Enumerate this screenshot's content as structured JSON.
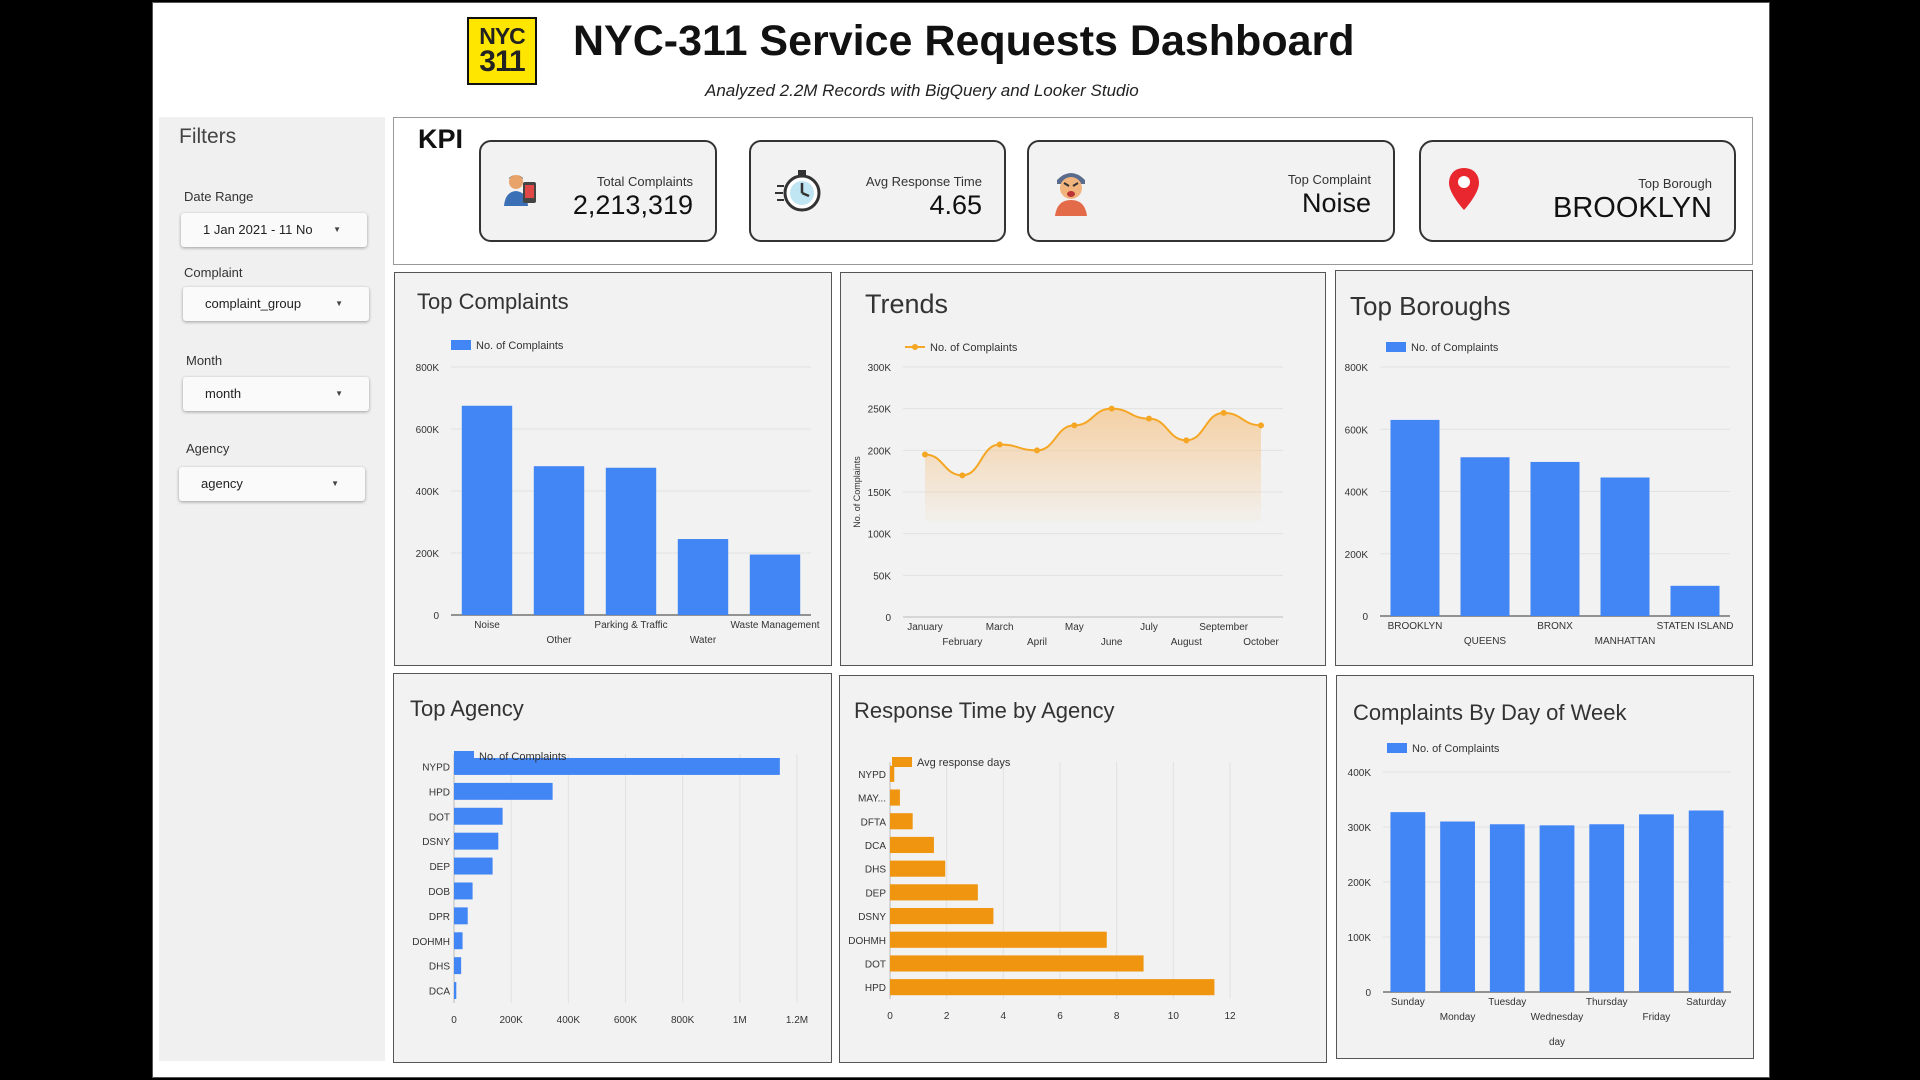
{
  "header": {
    "logo_line1": "NYC",
    "logo_line2": "311",
    "title": "NYC-311 Service Requests Dashboard",
    "subtitle": "Analyzed 2.2M  Records with BigQuery and Looker Studio"
  },
  "filters": {
    "title": "Filters",
    "items": [
      {
        "label": "Date Range",
        "value": "1 Jan 2021 - 11 No"
      },
      {
        "label": "Complaint",
        "value": "complaint_group"
      },
      {
        "label": "Month",
        "value": "month"
      },
      {
        "label": "Agency",
        "value": "agency"
      }
    ]
  },
  "kpi": {
    "title": "KPI",
    "cards": [
      {
        "label": "Total Complaints",
        "value": "2,213,319",
        "icon": "person-phone-icon"
      },
      {
        "label": "Avg Response Time",
        "value": "4.65",
        "icon": "stopwatch-icon"
      },
      {
        "label": "Top Complaint",
        "value": "Noise",
        "icon": "angry-person-icon"
      },
      {
        "label": "Top Borough",
        "value": "BROOKLYN",
        "icon": "map-pin-icon"
      }
    ]
  },
  "colors": {
    "blue": "#4285f4",
    "orange": "#f0950f",
    "line_orange": "#f5a623",
    "panel_bg": "#f2f2f2"
  },
  "chart_data": [
    {
      "id": "top_complaints",
      "type": "bar",
      "title": "Top Complaints",
      "legend": "No. of Complaints",
      "categories": [
        "Noise",
        "Other",
        "Parking & Traffic",
        "Water",
        "Waste Management"
      ],
      "values": [
        675000,
        480000,
        475000,
        245000,
        195000
      ],
      "yticks": [
        "0",
        "200K",
        "400K",
        "600K",
        "800K"
      ],
      "ylim": [
        0,
        800000
      ]
    },
    {
      "id": "trends",
      "type": "area",
      "title": "Trends",
      "legend": "No. of Complaints",
      "ylabel": "No. of Complaints",
      "categories": [
        "January",
        "February",
        "March",
        "April",
        "May",
        "June",
        "July",
        "August",
        "September",
        "October"
      ],
      "values": [
        195000,
        170000,
        207000,
        200000,
        230000,
        250000,
        238000,
        212000,
        245000,
        230000
      ],
      "yticks": [
        "0",
        "50K",
        "100K",
        "150K",
        "200K",
        "250K",
        "300K"
      ],
      "ylim": [
        0,
        300000
      ]
    },
    {
      "id": "top_boroughs",
      "type": "bar",
      "title": "Top Boroughs",
      "legend": "No. of Complaints",
      "categories": [
        "BROOKLYN",
        "QUEENS",
        "BRONX",
        "MANHATTAN",
        "STATEN ISLAND"
      ],
      "values": [
        630000,
        510000,
        495000,
        445000,
        97000
      ],
      "yticks": [
        "0",
        "200K",
        "400K",
        "600K",
        "800K"
      ],
      "ylim": [
        0,
        800000
      ]
    },
    {
      "id": "top_agency",
      "type": "bar",
      "orientation": "horizontal",
      "title": "Top Agency",
      "legend": "No. of Complaints",
      "categories": [
        "NYPD",
        "HPD",
        "DOT",
        "DSNY",
        "DEP",
        "DOB",
        "DPR",
        "DOHMH",
        "DHS",
        "DCA"
      ],
      "values": [
        1140000,
        345000,
        170000,
        155000,
        135000,
        65000,
        48000,
        30000,
        25000,
        8000
      ],
      "xticks": [
        "0",
        "200K",
        "400K",
        "600K",
        "800K",
        "1M",
        "1.2M"
      ],
      "xlim": [
        0,
        1200000
      ]
    },
    {
      "id": "response_time_by_agency",
      "type": "bar",
      "orientation": "horizontal",
      "title": "Response Time by Agency",
      "legend": "Avg response days",
      "categories": [
        "NYPD",
        "MAY...",
        "DFTA",
        "DCA",
        "DHS",
        "DEP",
        "DSNY",
        "DOHMH",
        "DOT",
        "HPD"
      ],
      "values": [
        0.15,
        0.35,
        0.8,
        1.55,
        1.95,
        3.1,
        3.65,
        7.65,
        8.95,
        11.45
      ],
      "xticks": [
        "0",
        "2",
        "4",
        "6",
        "8",
        "10",
        "12"
      ],
      "xlim": [
        0,
        12
      ]
    },
    {
      "id": "complaints_by_day",
      "type": "bar",
      "title": "Complaints By Day of Week",
      "legend": "No. of Complaints",
      "xlabel": "day",
      "categories": [
        "Sunday",
        "Monday",
        "Tuesday",
        "Wednesday",
        "Thursday",
        "Friday",
        "Saturday"
      ],
      "values": [
        327000,
        310000,
        305000,
        303000,
        305000,
        323000,
        330000
      ],
      "yticks": [
        "0",
        "100K",
        "200K",
        "300K",
        "400K"
      ],
      "ylim": [
        0,
        400000
      ]
    }
  ]
}
